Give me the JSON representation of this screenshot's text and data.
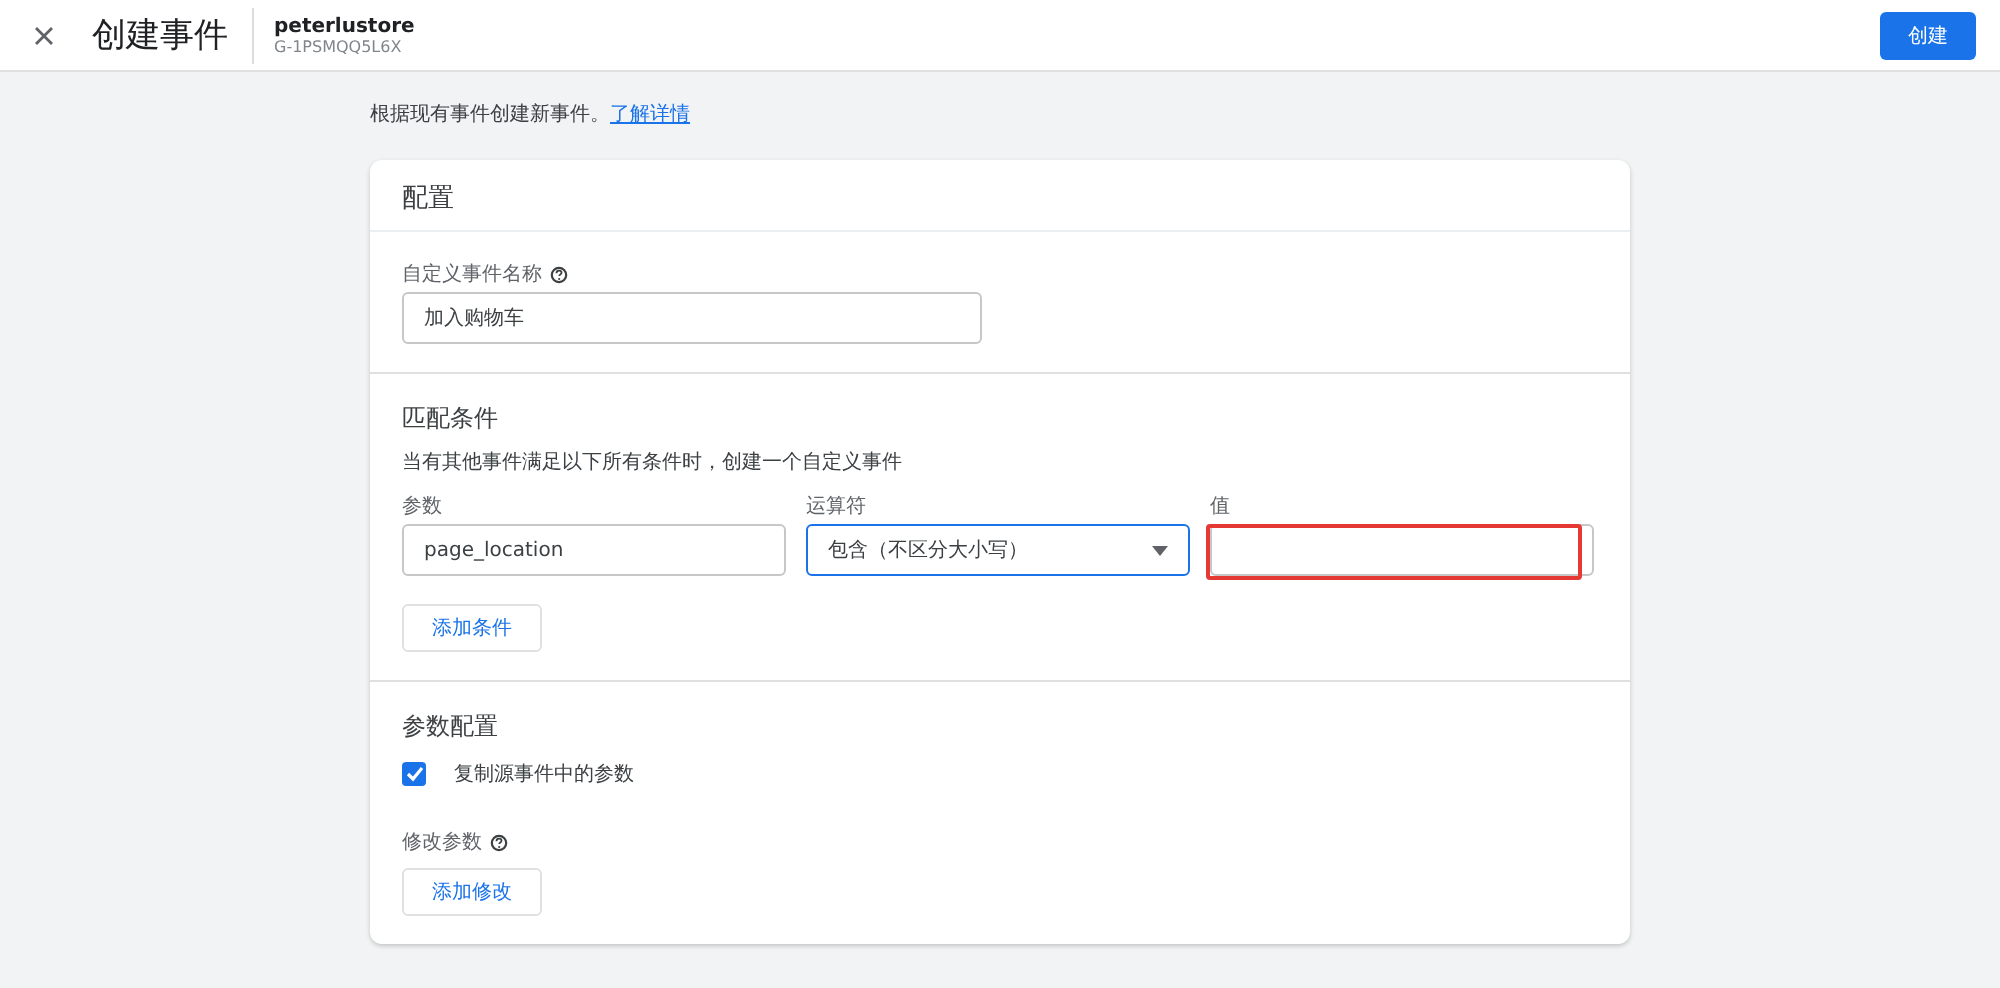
{
  "header": {
    "title": "创建事件",
    "property_name": "peterlustore",
    "property_id": "G-1PSMQQ5L6X",
    "create_button": "创建"
  },
  "intro": {
    "text": "根据现有事件创建新事件。",
    "link": "了解详情"
  },
  "card": {
    "title": "配置",
    "event_name": {
      "label": "自定义事件名称",
      "value": "加入购物车"
    },
    "match": {
      "title": "匹配条件",
      "description": "当有其他事件满足以下所有条件时，创建一个自定义事件",
      "fields": [
        {
          "kind": "text",
          "label": "参数",
          "value": "page_location",
          "focused": false,
          "highlighted": false
        },
        {
          "kind": "select",
          "label": "运算符",
          "value": "包含（不区分大小写）",
          "focused": true,
          "highlighted": false
        },
        {
          "kind": "text",
          "label": "值",
          "focused": false,
          "highlighted": true
        }
      ],
      "add_button": "添加条件"
    },
    "params": {
      "title": "参数配置",
      "copy_checkbox": {
        "label": "复制源事件中的参数",
        "checked": true
      },
      "modify_label": "修改参数",
      "add_button": "添加修改"
    }
  }
}
